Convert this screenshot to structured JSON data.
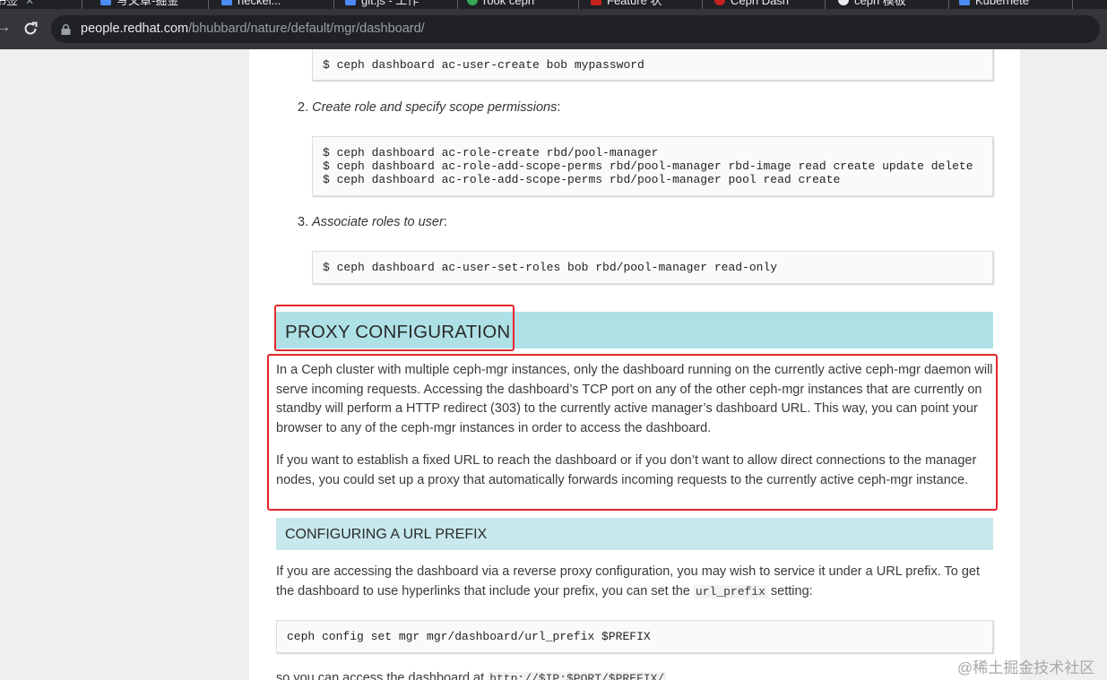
{
  "browser": {
    "tabs": [
      {
        "label": "书签",
        "favicon_color": "#e8eaed"
      },
      {
        "label": "写文章-掘金",
        "favicon_color": "#4c8bf5"
      },
      {
        "label": "heckel...",
        "favicon_color": "#4c8bf5"
      },
      {
        "label": "git.js - 工作",
        "favicon_color": "#4c8bf5"
      },
      {
        "label": "rook ceph",
        "favicon_color": "#34a853"
      },
      {
        "label": "Feature 状",
        "favicon_color": "#c5221f"
      },
      {
        "label": "Ceph Dash",
        "favicon_color": "#c5221f"
      },
      {
        "label": "ceph 模板",
        "favicon_color": "#e8eaed"
      },
      {
        "label": "Kubernete",
        "favicon_color": "#4c8bf5"
      }
    ],
    "url_host": "people.redhat.com",
    "url_path": "/bhubbard/nature/default/mgr/dashboard/"
  },
  "page": {
    "code_user_create": "$ ceph dashboard ac-user-create bob mypassword",
    "step2_num": "2.",
    "step2_text": "Create role and specify scope permissions",
    "step2_colon": ":",
    "code_role": "$ ceph dashboard ac-role-create rbd/pool-manager\n$ ceph dashboard ac-role-add-scope-perms rbd/pool-manager rbd-image read create update delete\n$ ceph dashboard ac-role-add-scope-perms rbd/pool-manager pool read create",
    "step3_num": "3.",
    "step3_text": "Associate roles to user",
    "step3_colon": ":",
    "code_set_roles": "$ ceph dashboard ac-user-set-roles bob rbd/pool-manager read-only",
    "h2_proxy": "PROXY CONFIGURATION",
    "proxy_para1": "In a Ceph cluster with multiple ceph-mgr instances, only the dashboard running on the currently active ceph-mgr daemon will serve incoming requests. Accessing the dashboard’s TCP port on any of the other ceph-mgr instances that are currently on standby will perform a HTTP redirect (303) to the currently active manager’s dashboard URL. This way, you can point your browser to any of the ceph-mgr instances in order to access the dashboard.",
    "proxy_para2": "If you want to establish a fixed URL to reach the dashboard or if you don’t want to allow direct connections to the manager nodes, you could set up a proxy that automatically forwards incoming requests to the currently active ceph-mgr instance.",
    "h3_prefix": "CONFIGURING A URL PREFIX",
    "prefix_para_start": "If you are accessing the dashboard via a reverse proxy configuration, you may wish to service it under a URL prefix. To get the dashboard to use hyperlinks that include your prefix, you can set the ",
    "prefix_para_code": "url_prefix",
    "prefix_para_end": " setting:",
    "code_prefix": "ceph config set mgr mgr/dashboard/url_prefix $PREFIX",
    "access_start": "so you can access the dashboard at ",
    "access_code": "http://$IP:$PORT/$PREFIX/"
  },
  "annotations": {
    "highlight_color": "#e3262a"
  },
  "watermark": "@稀土掘金技术社区"
}
